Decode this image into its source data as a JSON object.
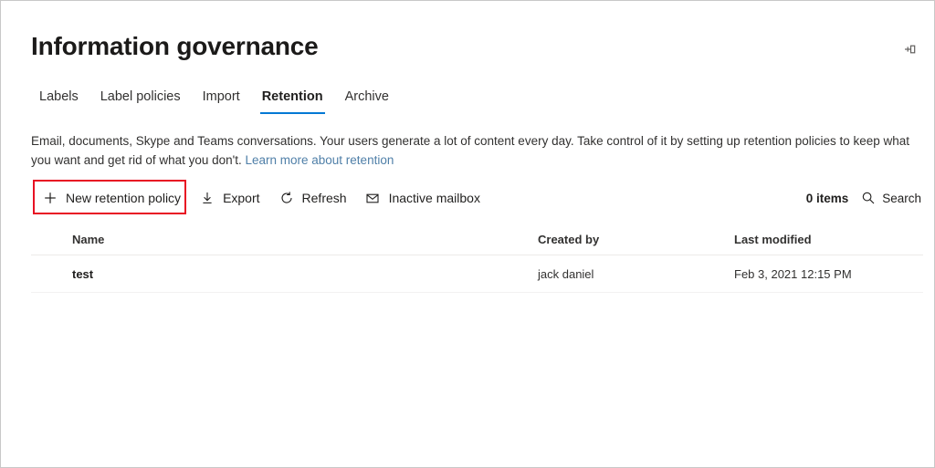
{
  "page": {
    "title": "Information governance",
    "pin_icon": "pin-icon"
  },
  "tabs": [
    {
      "label": "Labels",
      "active": false
    },
    {
      "label": "Label policies",
      "active": false
    },
    {
      "label": "Import",
      "active": false
    },
    {
      "label": "Retention",
      "active": true
    },
    {
      "label": "Archive",
      "active": false
    }
  ],
  "description": {
    "text": "Email, documents, Skype and Teams conversations. Your users generate a lot of content every day. Take control of it by setting up retention policies to keep what you want and get rid of what you don't. ",
    "link_text": "Learn more about retention"
  },
  "commandbar": {
    "new_policy": {
      "label": "New retention policy",
      "icon": "plus-icon"
    },
    "export": {
      "label": "Export",
      "icon": "download-icon"
    },
    "refresh": {
      "label": "Refresh",
      "icon": "refresh-icon"
    },
    "inactive_mailbox": {
      "label": "Inactive mailbox",
      "icon": "mail-icon"
    },
    "items_count": "0 items",
    "search": {
      "placeholder": "Search",
      "icon": "search-icon"
    },
    "highlight_color": "#e81123"
  },
  "list": {
    "columns": [
      "Name",
      "Created by",
      "Last modified"
    ],
    "rows": [
      {
        "name": "test",
        "created_by": "jack daniel",
        "last_modified": "Feb 3, 2021 12:15 PM"
      }
    ]
  },
  "colors": {
    "accent": "#0078d4",
    "link": "#4f7fa8",
    "highlight": "#e81123"
  }
}
